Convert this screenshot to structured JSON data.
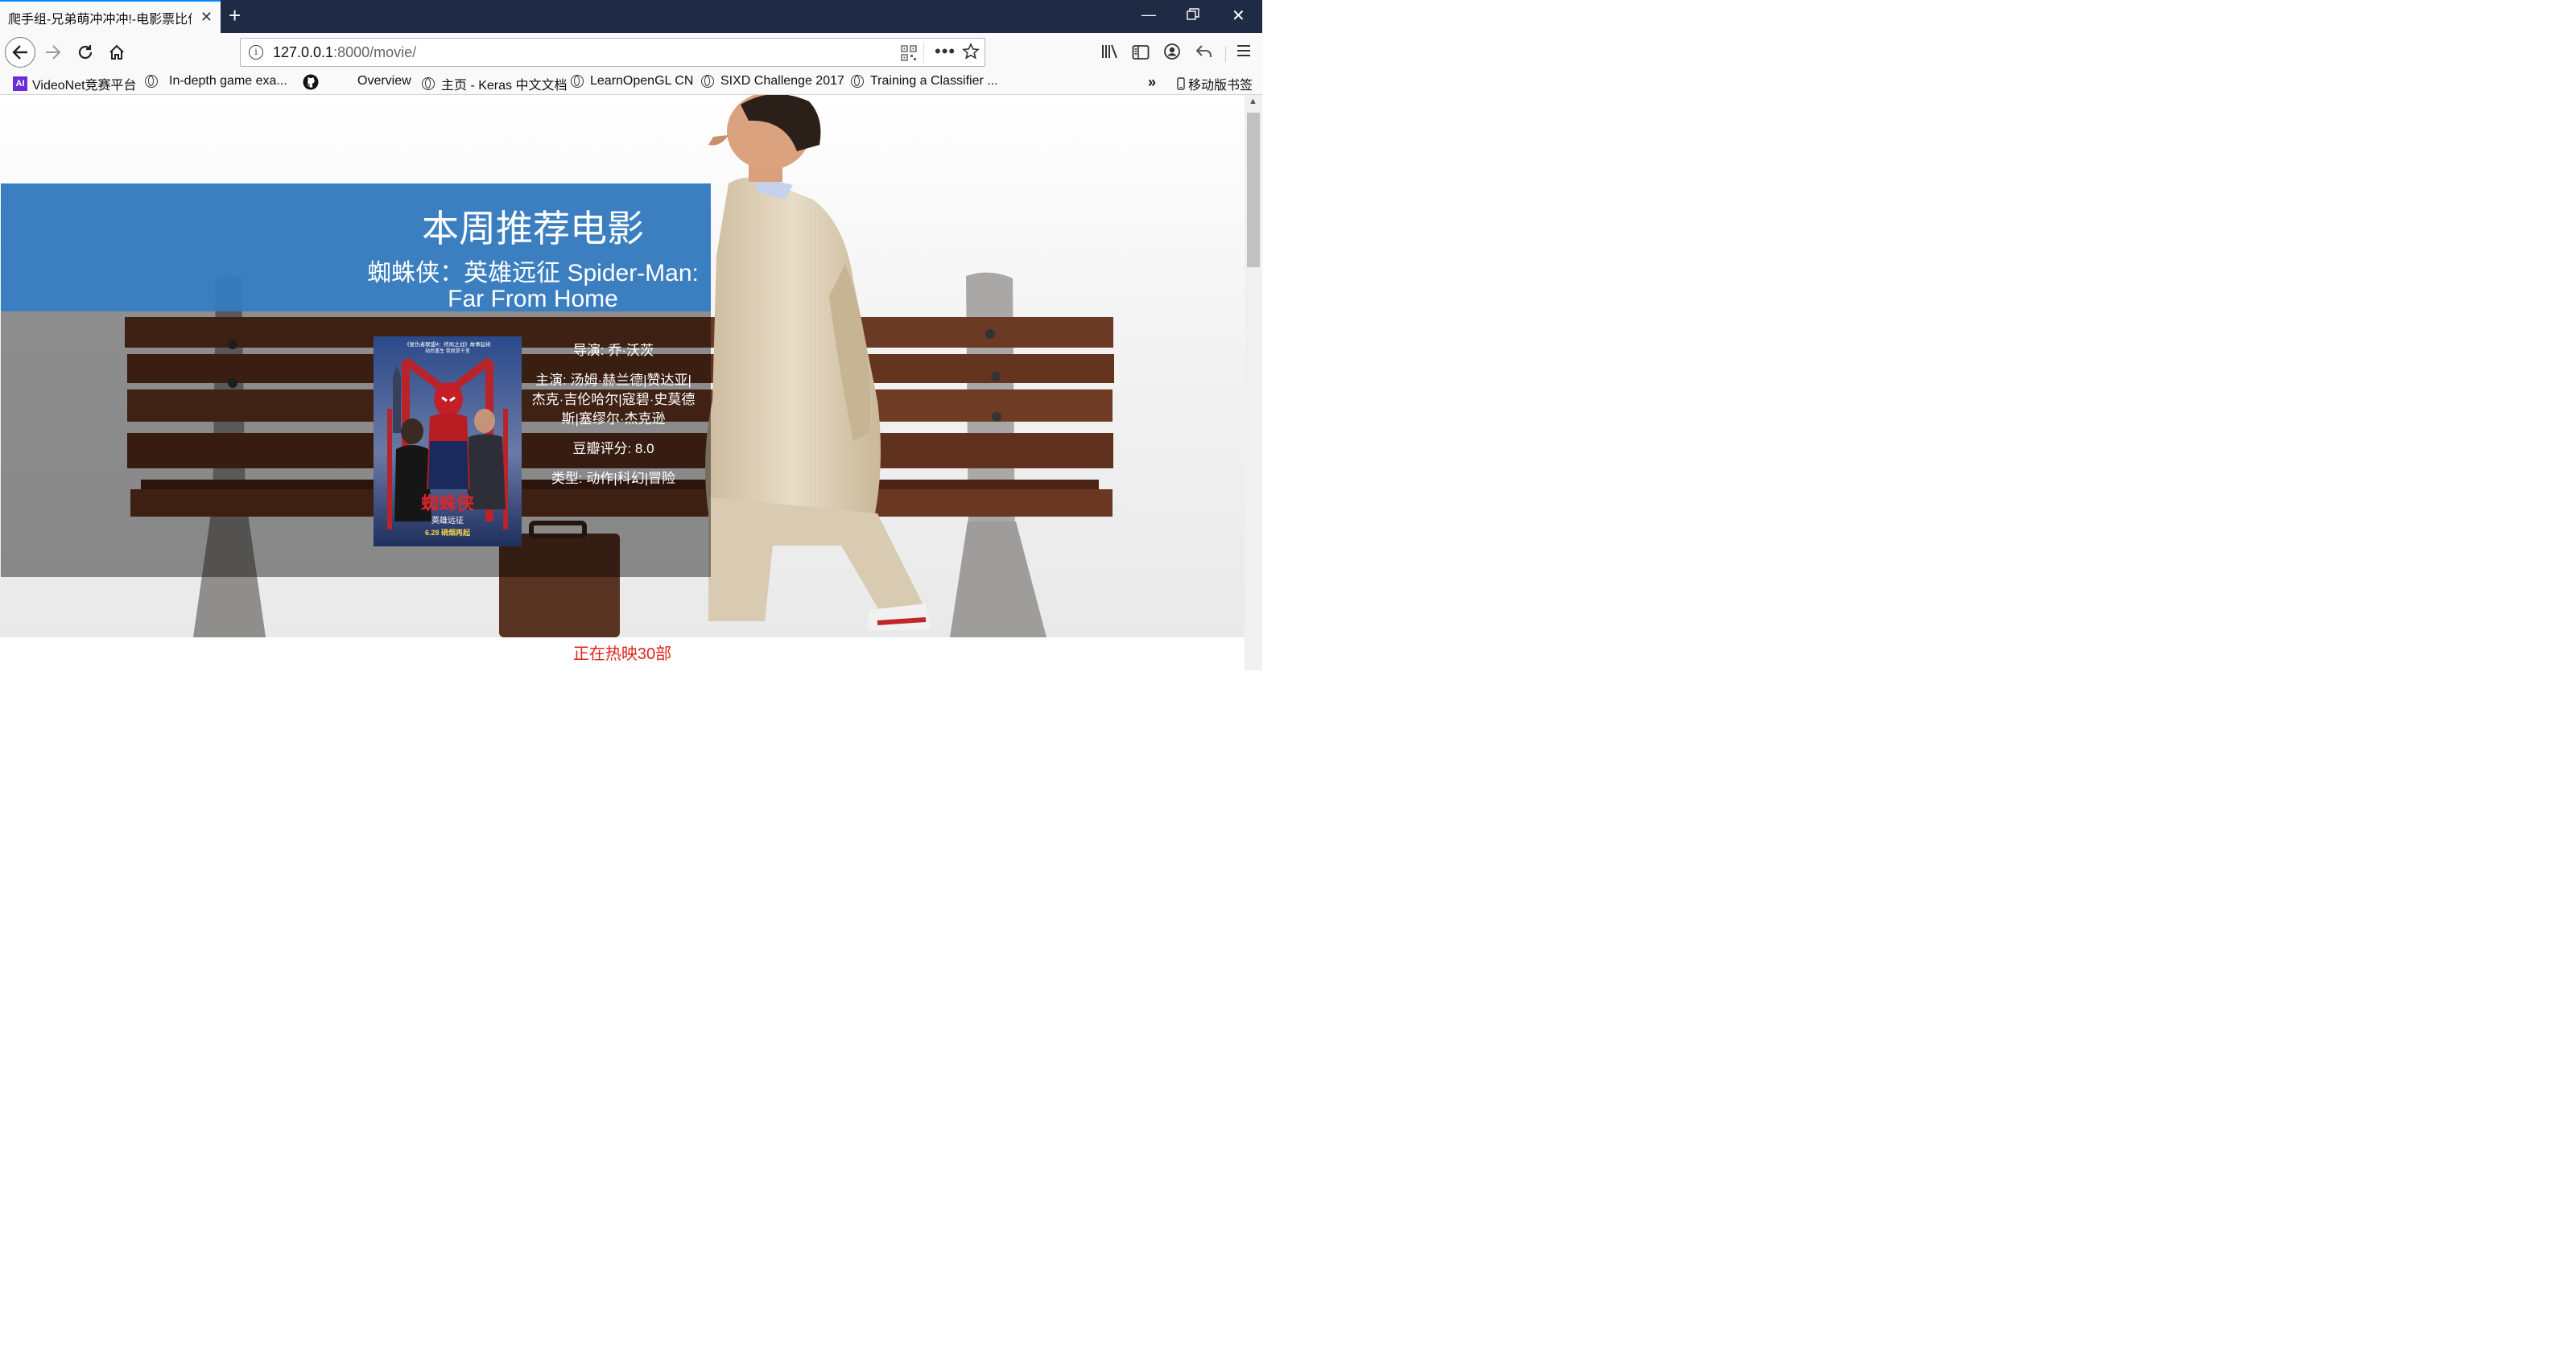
{
  "browser": {
    "tab_title": "爬手组-兄弟萌冲冲冲!-电影票比价",
    "url_host": "127.0.0.1",
    "url_path": ":8000/movie/"
  },
  "bookmarks": [
    {
      "label": "VideoNet竞赛平台",
      "icon": "ai-logo-icon"
    },
    {
      "label": "In-depth game exa...",
      "icon": "globe-icon"
    },
    {
      "label": "",
      "icon": "github-icon"
    },
    {
      "label": "Overview",
      "icon": "none"
    },
    {
      "label": "主页 - Keras 中文文档",
      "icon": "globe-icon"
    },
    {
      "label": "LearnOpenGL CN",
      "icon": "globe-icon"
    },
    {
      "label": "SIXD Challenge 2017",
      "icon": "globe-icon"
    },
    {
      "label": "Training a Classifier ...",
      "icon": "globe-icon"
    }
  ],
  "mobile_bookmarks": "移动版书签",
  "page": {
    "heading": "本周推荐电影",
    "movie": {
      "title": "蜘蛛侠：英雄远征 Spider-Man: Far From Home",
      "director": "导演: 乔·沃茨",
      "cast": "主演: 汤姆·赫兰德|赞达亚|杰克·吉伦哈尔|寇碧·史莫德斯|塞缪尔·杰克逊",
      "rating": "豆瓣评分: 8.0",
      "genre": "类型: 动作|科幻|冒险",
      "poster": {
        "top_text": "《复仇者联盟4：终局之战》故事延续",
        "sub_text": "劫后重生 我就是千里",
        "title": "蜘蛛侠",
        "subtitle": "英雄远征",
        "date": "6.28 硝烟再起"
      }
    },
    "now_showing": "正在热映30部"
  }
}
